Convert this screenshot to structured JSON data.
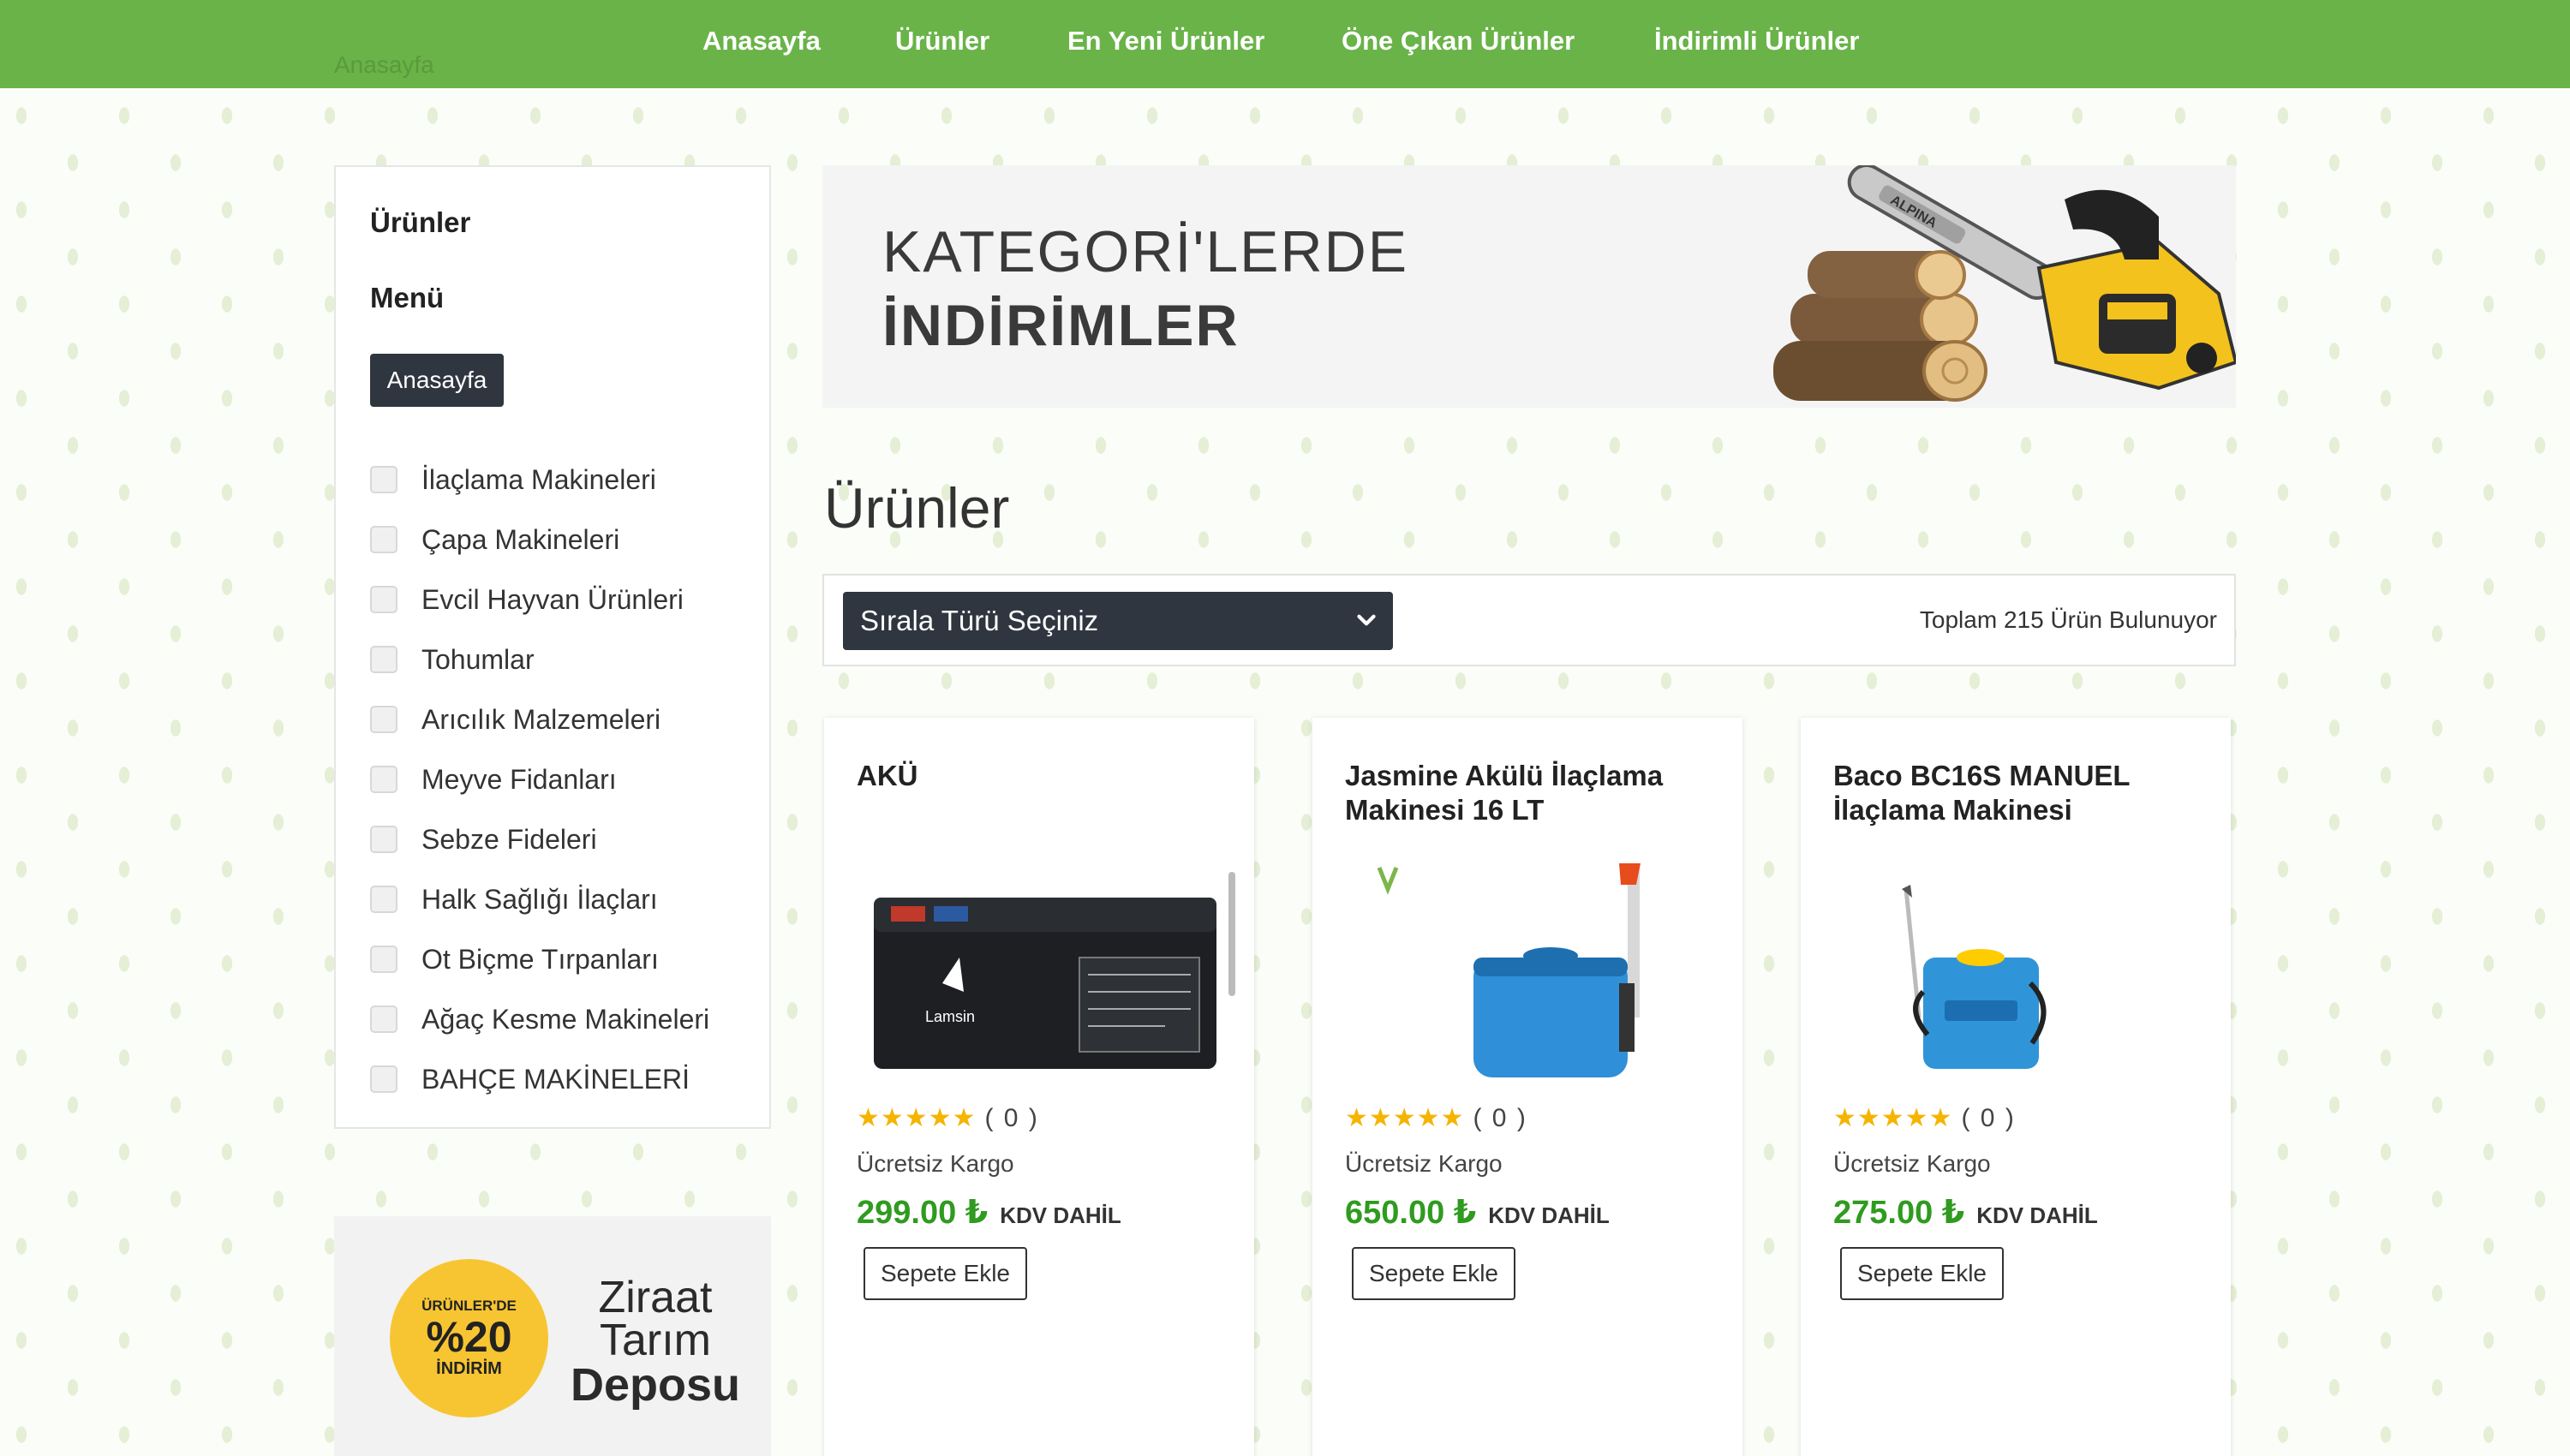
{
  "header": {
    "breadcrumb": "Anasayfa",
    "nav": [
      "Anasayfa",
      "Ürünler",
      "En Yeni Ürünler",
      "Öne Çıkan Ürünler",
      "İndirimli Ürünler"
    ]
  },
  "sidebar": {
    "title": "Ürünler",
    "menu_title": "Menü",
    "home_button": "Anasayfa",
    "categories": [
      "İlaçlama Makineleri",
      "Çapa Makineleri",
      "Evcil Hayvan Ürünleri",
      "Tohumlar",
      "Arıcılık Malzemeleri",
      "Meyve Fidanları",
      "Sebze Fideleri",
      "Halk Sağlığı İlaçları",
      "Ot Biçme Tırpanları",
      "Ağaç Kesme Makineleri",
      "BAHÇE MAKİNELERİ"
    ]
  },
  "promo": {
    "badge_top": "ÜRÜNLER'DE",
    "badge_value": "%20",
    "badge_bottom": "İNDİRİM",
    "line1": "Ziraat",
    "line2": "Tarım",
    "line3": "Deposu"
  },
  "banner": {
    "line1": "KATEGORİ'LERDE",
    "line2": "İNDİRİMLER",
    "brand": "ALPINA"
  },
  "main": {
    "title": "Ürünler",
    "sort_placeholder": "Sırala Türü Seçiniz",
    "total_text": "Toplam 215 Ürün Bulunuyor"
  },
  "products": [
    {
      "title": "AKÜ",
      "stars": "★★★★★",
      "reviews": "( 0 )",
      "shipping": "Ücretsiz Kargo",
      "price": "299.00 ₺",
      "tax": "KDV DAHİL",
      "button": "Sepete Ekle",
      "image": "battery-image"
    },
    {
      "title": "Jasmine Akülü İlaçlama Makinesi 16 LT",
      "stars": "★★★★★",
      "reviews": "( 0 )",
      "shipping": "Ücretsiz Kargo",
      "price": "650.00 ₺",
      "tax": "KDV DAHİL",
      "button": "Sepete Ekle",
      "image": "sprayer-image"
    },
    {
      "title": "Baco BC16S MANUEL İlaçlama Makinesi",
      "stars": "★★★★★",
      "reviews": "( 0 )",
      "shipping": "Ücretsiz Kargo",
      "price": "275.00 ₺",
      "tax": "KDV DAHİL",
      "button": "Sepete Ekle",
      "image": "sprayer-image"
    }
  ],
  "colors": {
    "nav_green": "#69b348",
    "price_green": "#2f9b1f",
    "dark_button": "#2f3640",
    "star_yellow": "#f5b400",
    "badge_yellow": "#f7c531"
  },
  "battery_label": "Lamsin"
}
